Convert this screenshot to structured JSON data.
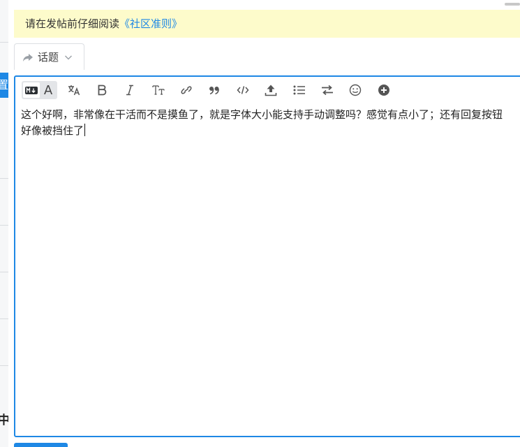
{
  "background_page": {
    "tab_fragment": "置",
    "bottom_fragment": "中"
  },
  "notice": {
    "text": "请在发帖前仔细阅读",
    "link": "《社区准则》"
  },
  "topic_button": {
    "label": "话题",
    "icon": "share-arrow-icon",
    "dropdown_icon": "chevron-down-icon"
  },
  "editor": {
    "mode_markdown_icon": "markdown-icon",
    "mode_rich_label": "A",
    "toolbar_icons": [
      "translate-icon",
      "bold-icon",
      "italic-icon",
      "heading-icon",
      "link-icon",
      "quote-icon",
      "code-icon",
      "upload-icon",
      "list-icon",
      "swap-icon",
      "emoji-icon",
      "plus-circle-icon"
    ],
    "content": "这个好啊，非常像在干活而不是摸鱼了，就是字体大小能支持手动调整吗？感觉有点小了；还有回复按钮好像被挡住了"
  },
  "colors": {
    "accent": "#1e88e5",
    "notice_bg": "#fdfbcb"
  }
}
